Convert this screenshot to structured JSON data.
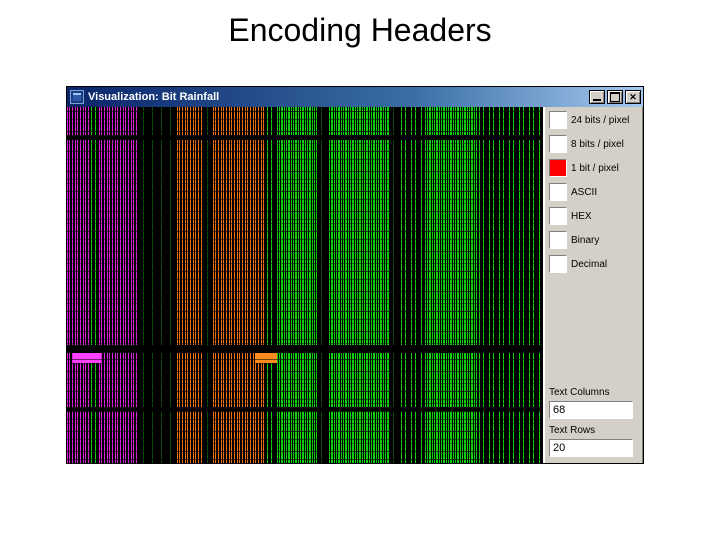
{
  "slide": {
    "title": "Encoding Headers"
  },
  "window": {
    "title": "Visualization: Bit Rainfall",
    "buttons": {
      "minimize": "minimize",
      "maximize": "maximize",
      "close": "close"
    }
  },
  "panel": {
    "options": [
      {
        "id": "opt-24bit",
        "label": "24 bits / pixel",
        "swatch": "#ffffff"
      },
      {
        "id": "opt-8bit",
        "label": "8 bits / pixel",
        "swatch": "#ffffff"
      },
      {
        "id": "opt-1bit",
        "label": "1 bit / pixel",
        "swatch": "#ff0000"
      },
      {
        "id": "opt-ascii",
        "label": "ASCII",
        "swatch": "#ffffff"
      },
      {
        "id": "opt-hex",
        "label": "HEX",
        "swatch": "#ffffff"
      },
      {
        "id": "opt-binary",
        "label": "Binary",
        "swatch": "#ffffff"
      },
      {
        "id": "opt-decimal",
        "label": "Decimal",
        "swatch": "#ffffff"
      }
    ],
    "text_columns": {
      "label": "Text Columns",
      "value": "68"
    },
    "text_rows": {
      "label": "Text Rows",
      "value": "20"
    }
  },
  "viz_colors": {
    "magenta": "#e020e0",
    "orange": "#f07010",
    "green": "#10d010",
    "bg": "#000000"
  }
}
